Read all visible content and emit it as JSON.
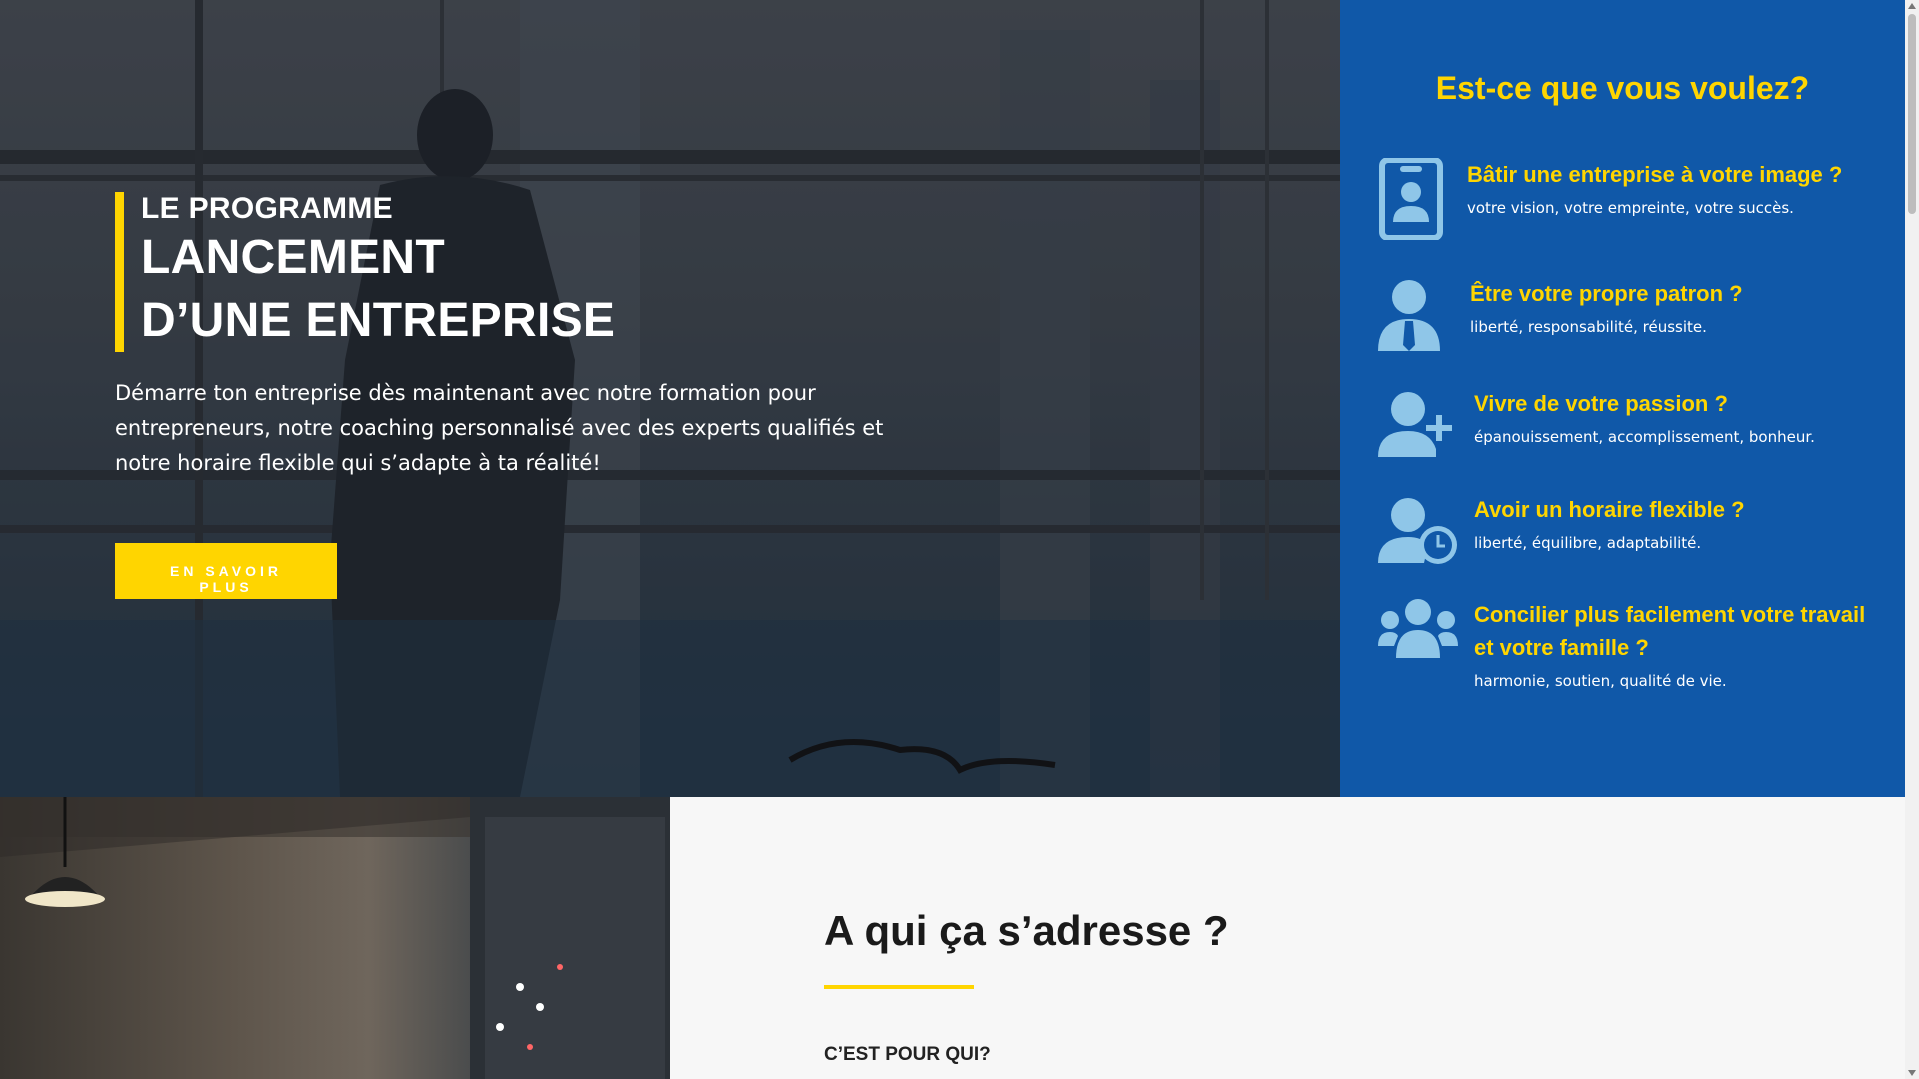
{
  "hero": {
    "kicker": "LE PROGRAMME",
    "title_line1": "LANCEMENT",
    "title_line2": "D’UNE ENTREPRISE",
    "lead": "Démarre ton entreprise dès maintenant avec notre formation pour entrepreneurs, notre coaching personnalisé avec des experts qualifiés et notre horaire flexible qui s’adapte à ta réalité!",
    "cta_label": "EN SAVOIR PLUS"
  },
  "panel": {
    "title": "Est-ce que vous voulez?",
    "features": [
      {
        "icon": "id-badge-icon",
        "title": "Bâtir une entreprise à votre image ?",
        "text": "votre vision, votre empreinte, votre succès."
      },
      {
        "icon": "user-tie-icon",
        "title": "Être votre propre patron ?",
        "text": "liberté, responsabilité, réussite."
      },
      {
        "icon": "user-plus-icon",
        "title": "Vivre de votre passion ?",
        "text": "épanouissement, accomplissement, bonheur."
      },
      {
        "icon": "user-clock-icon",
        "title": "Avoir un horaire flexible ?",
        "text": "liberté, équilibre, adaptabilité."
      },
      {
        "icon": "users-icon",
        "title_line1": "Concilier plus facilement votre travail",
        "title_line2": "et votre famille ?",
        "text": "harmonie, soutien, qualité de vie."
      }
    ]
  },
  "who": {
    "heading": "A qui ça s’adresse ?",
    "subheading": "C’EST POUR QUI?"
  },
  "colors": {
    "accent": "#ffd500",
    "panel_blue": "#1058a8",
    "icon_blue": "#8fc6e8"
  }
}
